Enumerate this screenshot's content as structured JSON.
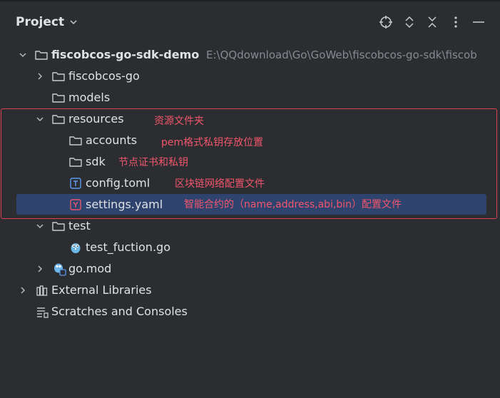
{
  "header": {
    "title": "Project"
  },
  "toolbar": {
    "icons": [
      "locate-icon",
      "expand-all-icon",
      "collapse-all-icon",
      "more-options-icon",
      "minimize-icon"
    ]
  },
  "tree": {
    "root_name": "fiscobcos-go-sdk-demo",
    "root_path": "E:\\QQdownload\\Go\\GoWeb\\fiscobcos-go-sdk\\fiscob",
    "items": [
      "fiscobcos-go",
      "models",
      "resources",
      "accounts",
      "sdk",
      "config.toml",
      "settings.yaml",
      "test",
      "test_fuction.go",
      "go.mod",
      "External Libraries",
      "Scratches and Consoles"
    ]
  },
  "annotations": {
    "resources": "资源文件夹",
    "accounts": "pem格式私钥存放位置",
    "sdk": "节点证书和私钥",
    "config": "区块链网络配置文件",
    "settings": "智能合约的（name,address,abi,bin）配置文件"
  },
  "colors": {
    "background": "#2b2d30",
    "selection": "#2e436e",
    "annotation": "#f2566c",
    "highlight_box": "#d9444f",
    "path_text": "#868a91"
  }
}
